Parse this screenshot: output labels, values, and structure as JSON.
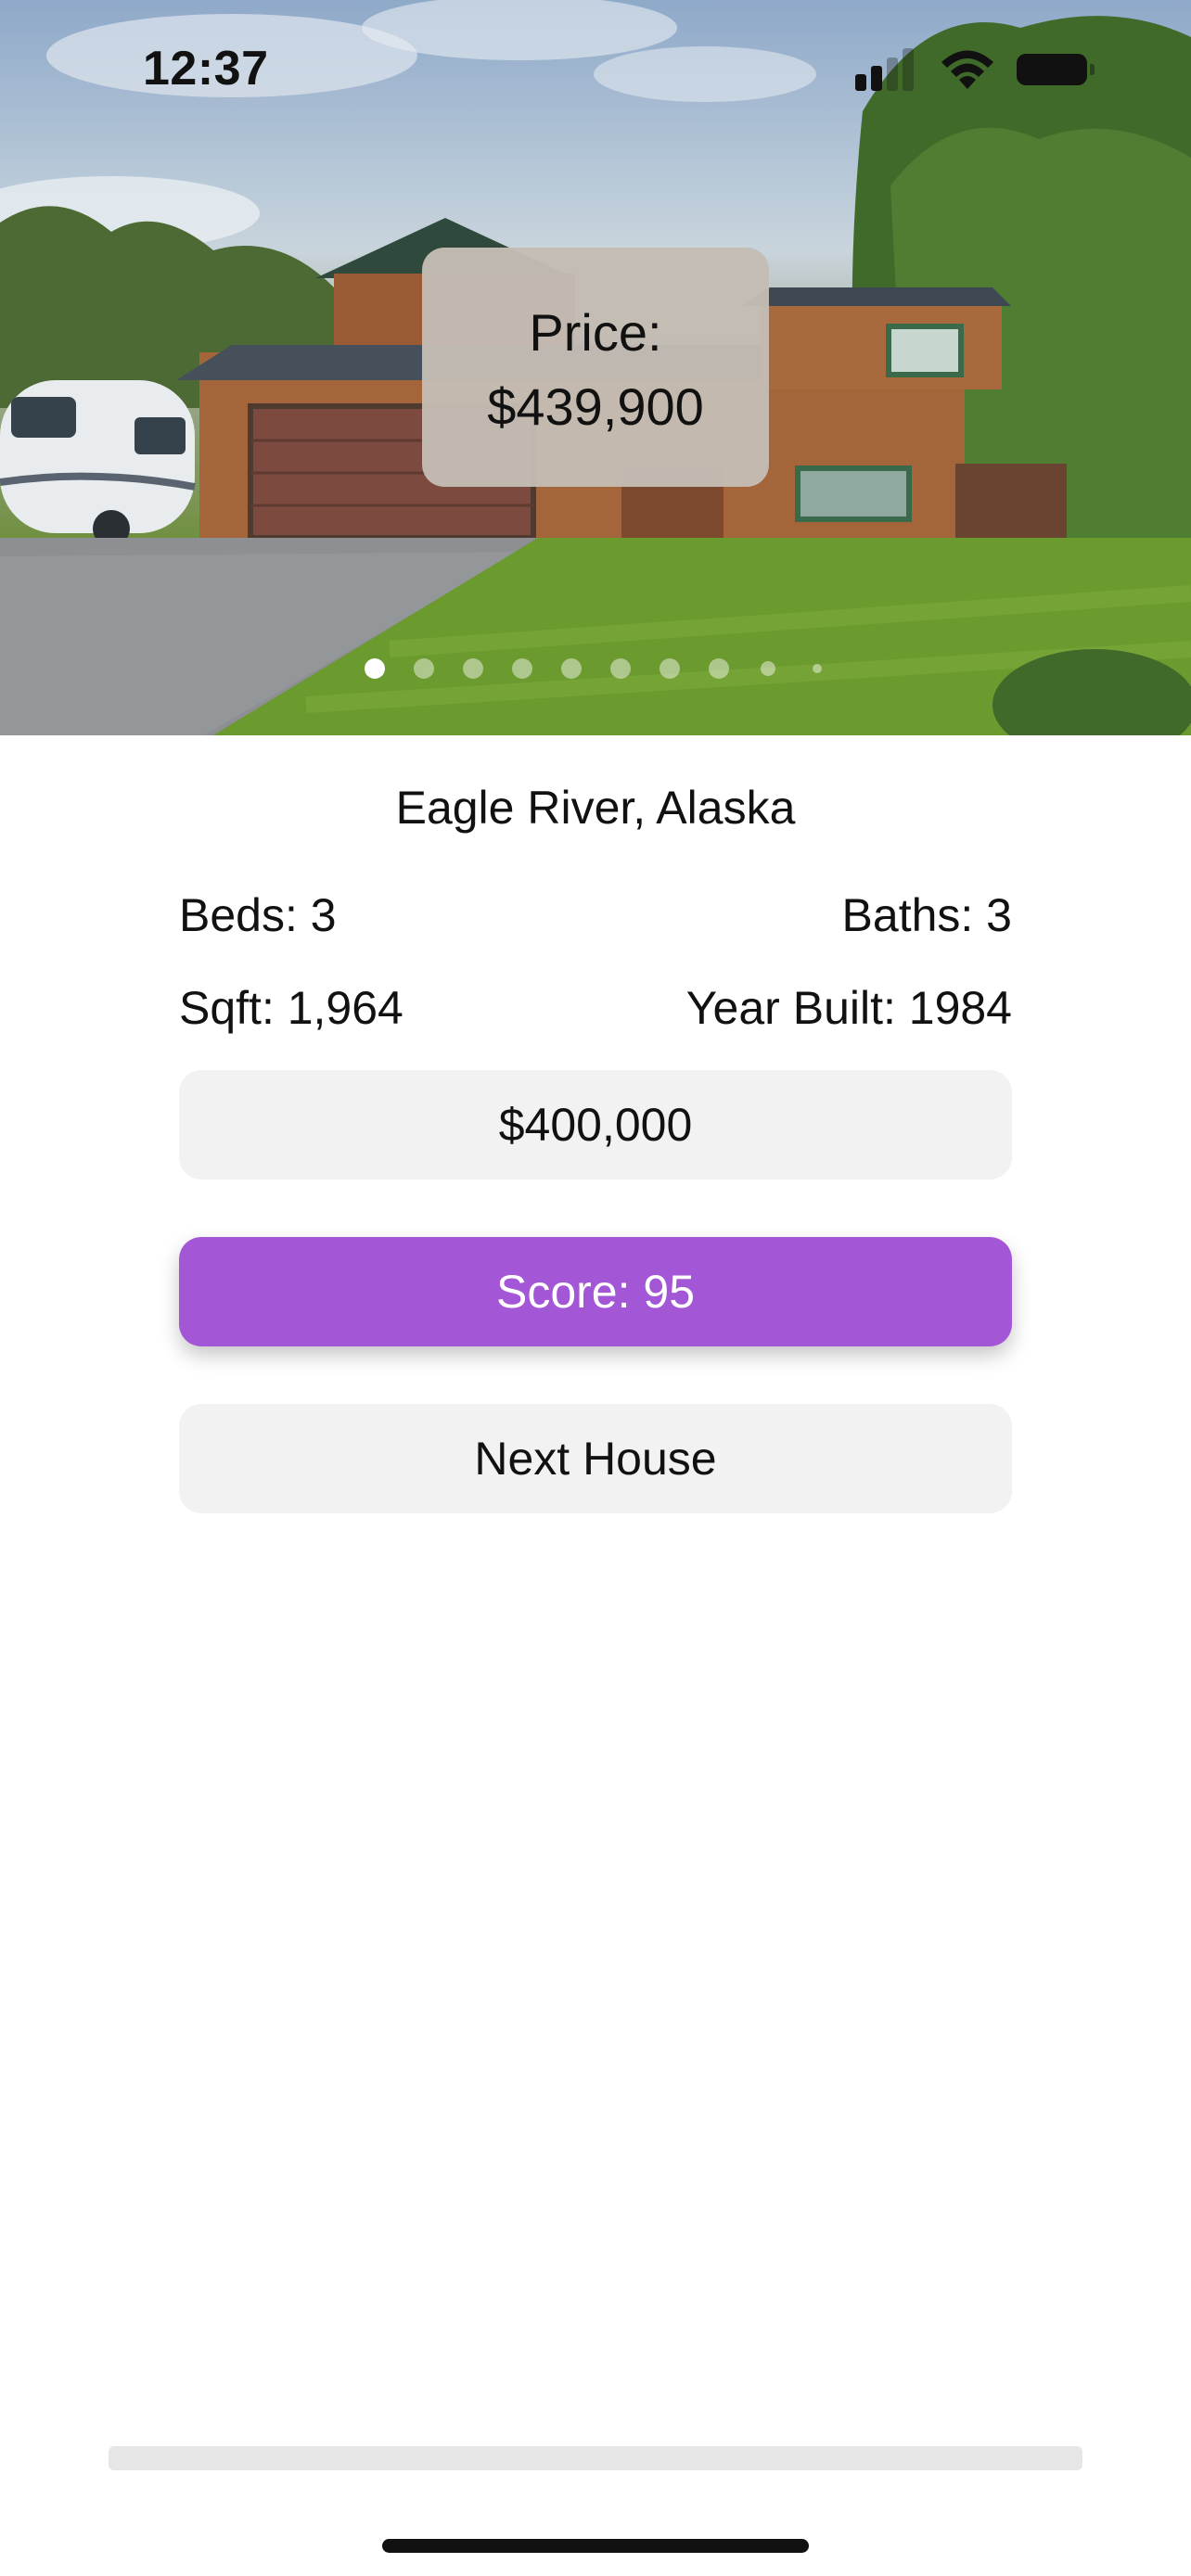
{
  "status_bar": {
    "time": "12:37",
    "signal_bars_active": 2,
    "signal_bars_total": 4
  },
  "listing": {
    "price_label": "Price:",
    "price_value": "$439,900",
    "photo_count": 10,
    "current_photo_index": 0,
    "location": "Eagle River, Alaska",
    "beds": "Beds: 3",
    "baths": "Baths: 3",
    "sqft": "Sqft: 1,964",
    "year_built": "Year Built: 1984"
  },
  "guess": {
    "value": "$400,000"
  },
  "actions": {
    "score_label": "Score: 95",
    "next_label": "Next House"
  },
  "progress": {
    "fraction": 0.0
  },
  "colors": {
    "accent": "#a356d6",
    "button_bg": "#f2f2f2",
    "price_card_bg": "#c4bcb4"
  },
  "icons": [
    "signal-icon",
    "wifi-icon",
    "battery-icon"
  ]
}
